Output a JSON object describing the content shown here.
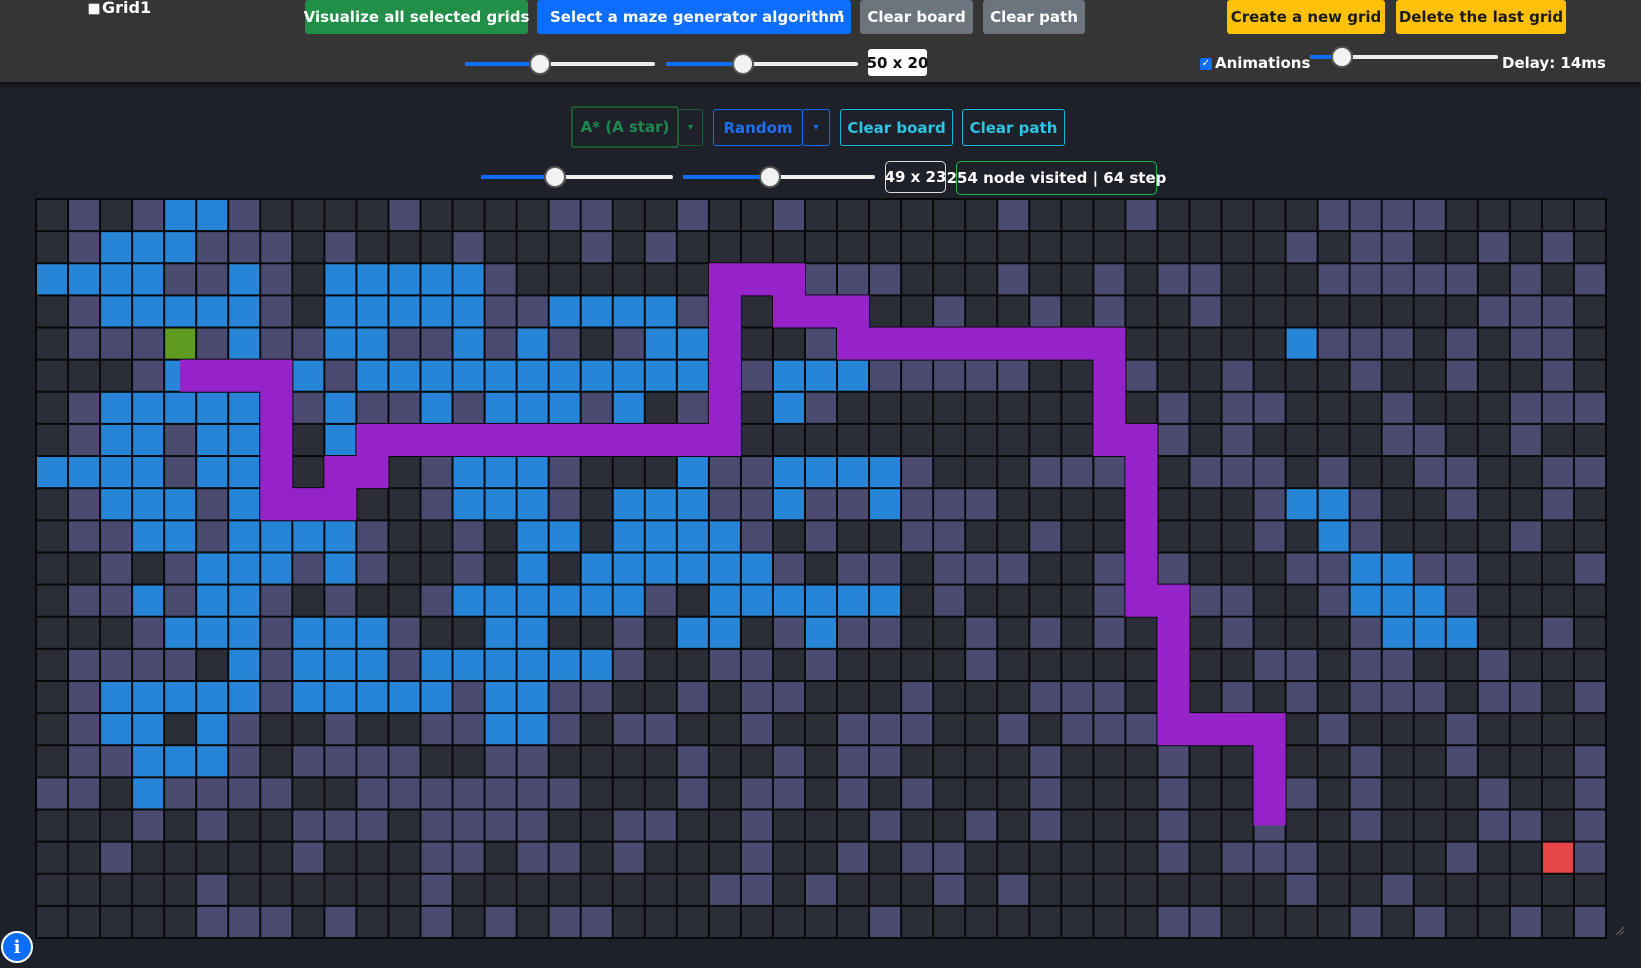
{
  "topbar": {
    "grid_checkbox_label": "Grid1",
    "visualize_button": "Visualize all selected grids",
    "maze_select": "Select a maze generator algorithm",
    "clear_board": "Clear board",
    "clear_path": "Clear path",
    "create_grid": "Create a new grid",
    "delete_grid": "Delete the last grid",
    "size_display": "50 x 20",
    "animations_label": "Animations",
    "animations_checked": true,
    "delay_label": "Delay: 14ms",
    "row_slider_value": 0.42,
    "col_slider_value": 0.4,
    "delay_slider_value": 0.17
  },
  "grid_toolbar": {
    "algorithm_select": "A* (A star)",
    "maze_select": "Random",
    "clear_board": "Clear board",
    "clear_path": "Clear path",
    "size_display": "49 x 23",
    "result_display": "254 node visited | 64 step",
    "row_slider_value": 0.39,
    "col_slider_value": 0.45
  },
  "grid": {
    "cols": 49,
    "rows": 23,
    "legend": {
      ".": "empty",
      "#": "wall",
      "v": "visited",
      "s": "start",
      "e": "end"
    },
    "cell_rows": [
      ".#.#vv#....#....##..#..#......#...#.....####.....#",
      ".#vvv###.#...#...#.#...................#.##..#.#.#",
      "vvvv##v#.vvvvv#.......#####...#..#.##...#####.#.#.",
      ".#vvvvv#.vvvvv##vvvv##.#....#..#.#..#........###.#",
      ".###s#v##vv##v#v#.#vv#..#.#...###......v###.#.##..",
      "...#v#..v#vvvvvvvvvvvv#vvv#####...#..#...#..#..#..",
      ".#vvvvv##v##v#vvv#v.#v.v#..........#.##...#...####",
      ".#vv#vv#.v#.v.....................##.#....##..#..#",
      "vvvv#vv..##.#vvv#...v##vvvv#...###..###.#..##..##.",
      ".#vvv#v#.#..#vvv#.vvv##v##v###........#vv#..#..#..",
      ".##vv#vvvv#..#.vv.vvvv#.#..##..#......#.v#....#..#",
      "..#.#vvv#v#..#.v.vvvvvv#.##.###..#.#...##vv##...#.",
      ".##v#vv#.#..#vvvvvv#.vvvvvv.#....#####..#vvv#....#",
      "...#vvv#vvv#..vv..#.vv.#v##..#.#.#...#...#vvv..#.#",
      ".####.v#vvv#vvvvvv#..##.#....#.....#..##.##..#....",
      ".#vvvvv#vvvvv#vv##..#.##...#...###.#.#.#.###.##.##",
      ".#vv.v#..#..##vv#.##..#..###..#.###.#...#...#....##",
      ".##vvv#.####..##....#..#.##....#...#..#..#..#...#.",
      "##.v####..#######...#.##.#.#...#...#..##.#...#..#.",
      "...#.#..###.####..##..#...#..#.#...#..#..#...##.#.",
      "..#.....#...##.##.#...#..#.##......#.###....#..e###",
      ".....#......#........##.#...#.#........#..#.......",
      ".....###.#..#.#.##........#........##....#.#..#.#."
    ],
    "path": [
      [
        4,
        5
      ],
      [
        7,
        5
      ],
      [
        7,
        9
      ],
      [
        9,
        9
      ],
      [
        9,
        8
      ],
      [
        10,
        8
      ],
      [
        10,
        7
      ],
      [
        21,
        7
      ],
      [
        21,
        2
      ],
      [
        23,
        2
      ],
      [
        23,
        3
      ],
      [
        25,
        3
      ],
      [
        25,
        4
      ],
      [
        33,
        4
      ],
      [
        33,
        7
      ],
      [
        34,
        7
      ],
      [
        34,
        12
      ],
      [
        35,
        12
      ],
      [
        35,
        16
      ],
      [
        38,
        16
      ],
      [
        38,
        19
      ]
    ],
    "colors": {
      "empty": "#2b2d37",
      "wall": "#4b4a71",
      "visited": "#2685d7",
      "path": "#9523c9",
      "start": "#5e9b20",
      "end": "#e64646"
    }
  }
}
